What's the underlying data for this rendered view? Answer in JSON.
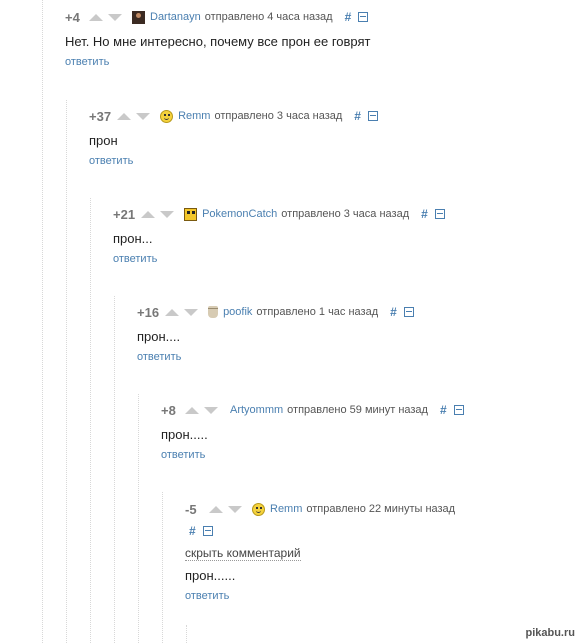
{
  "comments": [
    {
      "rating": "+4",
      "author": "Dartanayn",
      "posted": "отправлено 4 часа назад",
      "hash": "#",
      "text": "Нет. Но мне интересно, почему все прон ее говрят",
      "reply": "ответить",
      "avatar": "dark-portrait-icon"
    },
    {
      "rating": "+37",
      "author": "Remm",
      "posted": "отправлено 3 часа назад",
      "hash": "#",
      "text": "прон",
      "reply": "ответить",
      "avatar": "smiley-icon"
    },
    {
      "rating": "+21",
      "author": "PokemonCatch",
      "posted": "отправлено 3 часа назад",
      "hash": "#",
      "text": "прон...",
      "reply": "ответить",
      "avatar": "pikachu-icon"
    },
    {
      "rating": "+16",
      "author": "poofik",
      "posted": "отправлено 1 час назад",
      "hash": "#",
      "text": "прон....",
      "reply": "ответить",
      "avatar": "cup-icon"
    },
    {
      "rating": "+8",
      "author": "Artyommm",
      "posted": "отправлено 59 минут назад",
      "hash": "#",
      "text": "прон.....",
      "reply": "ответить",
      "avatar": ""
    },
    {
      "rating": "-5",
      "author": "Remm",
      "posted": "отправлено 22 минуты назад",
      "hash": "#",
      "hide": "скрыть комментарий",
      "text": "прон......",
      "reply": "ответить",
      "avatar": "smiley-icon"
    }
  ],
  "watermark": "pikabu.ru"
}
